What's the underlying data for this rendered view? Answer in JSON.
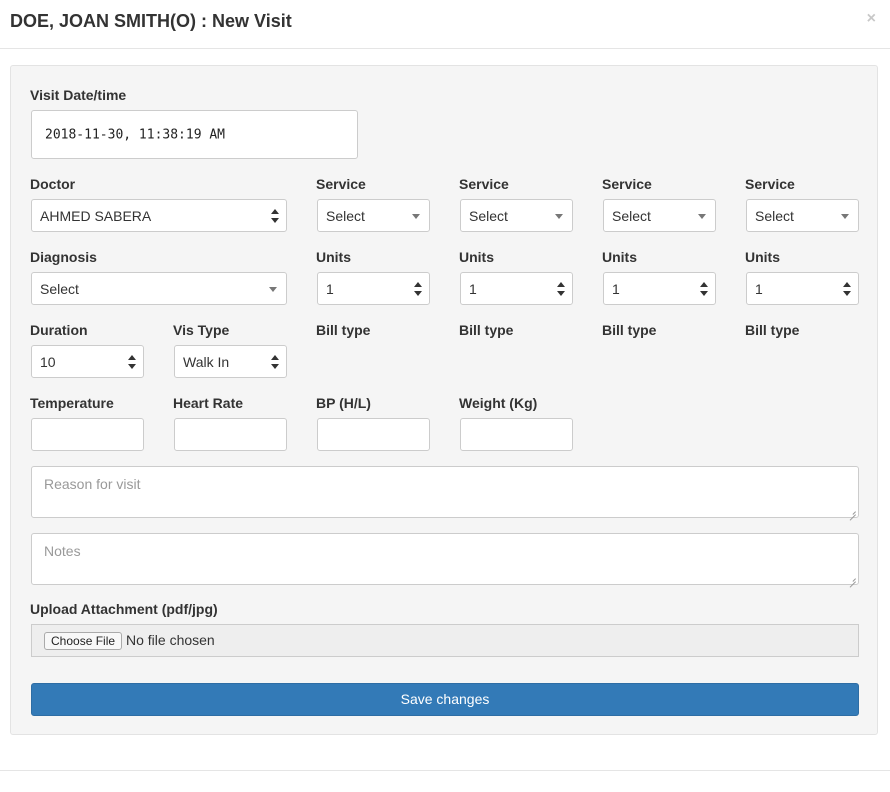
{
  "modal": {
    "title": "DOE, JOAN SMITH(O) : New Visit",
    "close_symbol": "×"
  },
  "visit_datetime": {
    "label": "Visit Date/time",
    "value": "2018-11-30, 11:38:19 AM"
  },
  "doctor": {
    "label": "Doctor",
    "value": "AHMED SABERA"
  },
  "services": [
    {
      "label": "Service",
      "value": "Select"
    },
    {
      "label": "Service",
      "value": "Select"
    },
    {
      "label": "Service",
      "value": "Select"
    },
    {
      "label": "Service",
      "value": "Select"
    }
  ],
  "diagnosis": {
    "label": "Diagnosis",
    "value": "Select"
  },
  "units": [
    {
      "label": "Units",
      "value": "1"
    },
    {
      "label": "Units",
      "value": "1"
    },
    {
      "label": "Units",
      "value": "1"
    },
    {
      "label": "Units",
      "value": "1"
    }
  ],
  "duration": {
    "label": "Duration",
    "value": "10"
  },
  "vis_type": {
    "label": "Vis Type",
    "value": "Walk In"
  },
  "bill_types": [
    "Bill type",
    "Bill type",
    "Bill type",
    "Bill type"
  ],
  "vitals": {
    "temperature": {
      "label": "Temperature",
      "value": ""
    },
    "heart_rate": {
      "label": "Heart Rate",
      "value": ""
    },
    "bp": {
      "label": "BP (H/L)",
      "value": ""
    },
    "weight": {
      "label": "Weight (Kg)",
      "value": ""
    }
  },
  "reason": {
    "placeholder": "Reason for visit"
  },
  "notes": {
    "placeholder": "Notes"
  },
  "upload": {
    "label": "Upload Attachment (pdf/jpg)",
    "button_label": "Choose File",
    "status": "No file chosen"
  },
  "save_label": "Save changes",
  "colors": {
    "primary": "#337ab7",
    "well": "#f5f5f5"
  }
}
